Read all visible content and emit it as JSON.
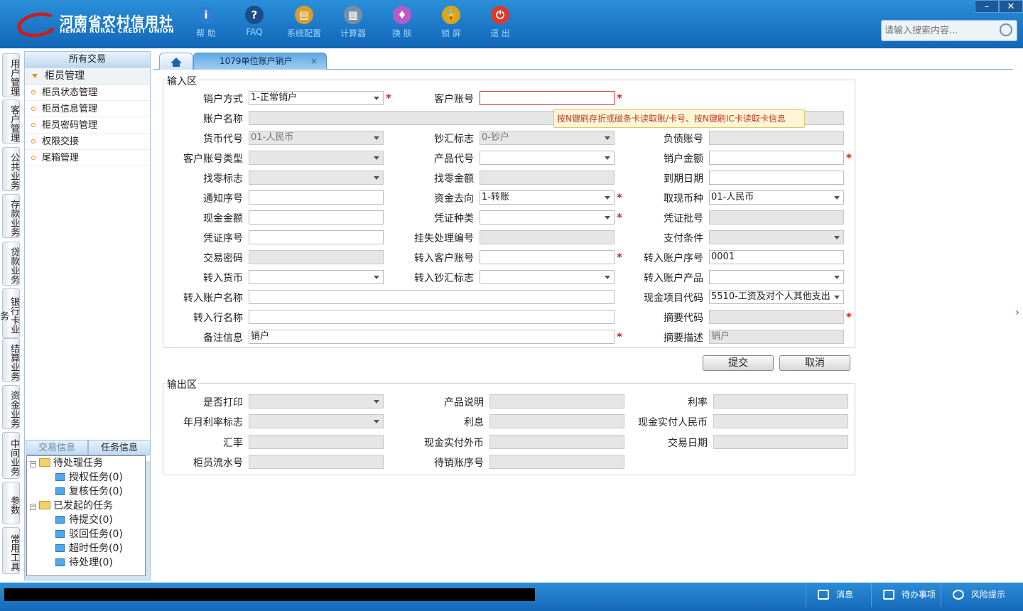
{
  "app": {
    "logo_cn": "河南省农村信用社",
    "logo_en": "HENAN RURAL CREDIT UNION"
  },
  "toolbar": [
    {
      "label": "帮 助",
      "icon": "info-icon",
      "color": "#2e7dd4",
      "glyph": "i"
    },
    {
      "label": "FAQ",
      "icon": "help-icon",
      "color": "#1b4d8a",
      "glyph": "?"
    },
    {
      "label": "系统配置",
      "icon": "toolbox-icon",
      "color": "#d99b2b",
      "glyph": "▤"
    },
    {
      "label": "计算器",
      "icon": "calculator-icon",
      "color": "#7a8ea3",
      "glyph": "▦"
    },
    {
      "label": "换 肤",
      "icon": "shirt-icon",
      "color": "#b35bc9",
      "glyph": "♦"
    },
    {
      "label": "锁 屏",
      "icon": "lock-icon",
      "color": "#d8a51f",
      "glyph": "🔒"
    },
    {
      "label": "退 出",
      "icon": "power-icon",
      "color": "#d93a2b",
      "glyph": "⏻"
    }
  ],
  "window": {
    "minimize": "–",
    "close": "✕"
  },
  "search": {
    "placeholder": "请输入搜索内容..."
  },
  "vtabs": [
    "用户管理",
    "客户管理",
    "公共业务",
    "存款业务",
    "贷款业务",
    "银行卡业务",
    "结算业务",
    "资金业务",
    "中间业务",
    "参数",
    "常用工具"
  ],
  "sidebar": {
    "header": "所有交易",
    "section": "柜员管理",
    "items": [
      "柜员状态管理",
      "柜员信息管理",
      "柜员密码管理",
      "权限交接",
      "尾箱管理"
    ]
  },
  "task_tabs": [
    "交易信息",
    "任务信息"
  ],
  "tree": {
    "pending": "待处理任务",
    "auth": "授权任务(0)",
    "review": "复核任务(0)",
    "initiated": "已发起的任务",
    "to_submit": "待提交(0)",
    "rejected": "驳回任务(0)",
    "timeout": "超时任务(0)",
    "to_process": "待处理(0)"
  },
  "tab": {
    "title": "1079单位账户销户",
    "close": "×"
  },
  "input_area": {
    "legend": "输入区",
    "xhfs": {
      "label": "销户方式",
      "value": "1-正常销户"
    },
    "khzh": {
      "label": "客户账号",
      "value": ""
    },
    "zhmc": {
      "label": "账户名称",
      "value": ""
    },
    "hbdh": {
      "label": "货币代号",
      "value": "01-人民币"
    },
    "chbz": {
      "label": "钞汇标志",
      "value": "0-钞户"
    },
    "fzzh": {
      "label": "负债账号",
      "value": ""
    },
    "khzhlx": {
      "label": "客户账号类型",
      "value": ""
    },
    "cpdh": {
      "label": "产品代号",
      "value": ""
    },
    "xhje": {
      "label": "销户金额",
      "value": ""
    },
    "zlbz": {
      "label": "找零标志",
      "value": ""
    },
    "zlje": {
      "label": "找零金额",
      "value": ""
    },
    "dqrq": {
      "label": "到期日期",
      "value": ""
    },
    "tzxh": {
      "label": "通知序号",
      "value": ""
    },
    "zjqx": {
      "label": "资金去向",
      "value": "1-转账"
    },
    "qxbz": {
      "label": "取现币种",
      "value": "01-人民币"
    },
    "xjje": {
      "label": "现金金额",
      "value": ""
    },
    "pzzl": {
      "label": "凭证种类",
      "value": ""
    },
    "pzph": {
      "label": "凭证批号",
      "value": ""
    },
    "pzxh": {
      "label": "凭证序号",
      "value": ""
    },
    "gsclbh": {
      "label": "挂失处理编号",
      "value": ""
    },
    "zftj": {
      "label": "支付条件",
      "value": ""
    },
    "jymm": {
      "label": "交易密码",
      "value": ""
    },
    "zrkhzh": {
      "label": "转入客户账号",
      "value": ""
    },
    "zrzhxh": {
      "label": "转入账户序号",
      "value": "0001"
    },
    "zrhb": {
      "label": "转入货币",
      "value": ""
    },
    "zrchbz": {
      "label": "转入钞汇标志",
      "value": ""
    },
    "zrzhcp": {
      "label": "转入账户产品",
      "value": ""
    },
    "zrzhmc": {
      "label": "转入账户名称",
      "value": ""
    },
    "xjxmdm": {
      "label": "现金项目代码",
      "value": "5510-工资及对个人其他支出"
    },
    "zrhmc": {
      "label": "转入行名称",
      "value": ""
    },
    "zydm": {
      "label": "摘要代码",
      "value": ""
    },
    "bzxx": {
      "label": "备注信息",
      "value": "销户"
    },
    "zyms": {
      "label": "摘要描述",
      "value": "销户"
    },
    "tooltip": "按N键刷存折或磁条卡读取账/卡号、按N键刷IC卡读取卡信息"
  },
  "buttons": {
    "submit": "提交",
    "cancel": "取消"
  },
  "output_area": {
    "legend": "输出区",
    "sfdy": {
      "label": "是否打印",
      "value": ""
    },
    "cpsm": {
      "label": "产品说明",
      "value": ""
    },
    "ll": {
      "label": "利率",
      "value": ""
    },
    "nyllbz": {
      "label": "年月利率标志",
      "value": ""
    },
    "lx": {
      "label": "利息",
      "value": ""
    },
    "xjsfrmb": {
      "label": "现金实付人民币",
      "value": ""
    },
    "hl": {
      "label": "汇率",
      "value": ""
    },
    "xjsfwb": {
      "label": "现金实付外币",
      "value": ""
    },
    "jyrq": {
      "label": "交易日期",
      "value": ""
    },
    "gylsh": {
      "label": "柜员流水号",
      "value": ""
    },
    "dxzhxh": {
      "label": "待销账序号",
      "value": ""
    }
  },
  "status": {
    "message": "消息",
    "todo": "待办事项",
    "risk": "风险提示"
  }
}
